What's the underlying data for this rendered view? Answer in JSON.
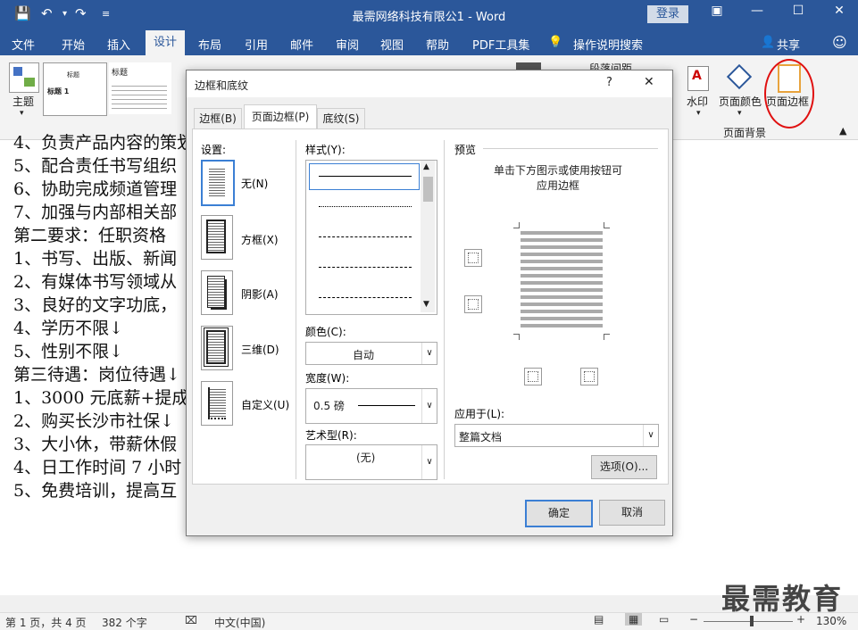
{
  "titlebar": {
    "title": "最需网络科技有限公1  -  Word",
    "login": "登录"
  },
  "menu": {
    "tabs": [
      "文件",
      "开始",
      "插入",
      "设计",
      "布局",
      "引用",
      "邮件",
      "审阅",
      "视图",
      "帮助",
      "PDF工具集"
    ],
    "tell_me": "操作说明搜索",
    "share": "共享"
  },
  "ribbon": {
    "theme_label": "主题",
    "style_title": "标题",
    "style_h1": "标题 1",
    "watermark": "水印",
    "page_color": "页面颜色",
    "page_borders": "页面边框",
    "group_page_bg": "页面背景",
    "paragraph_spacing": "段落间距"
  },
  "document": {
    "lines": [
      "4、负责产品内容的策划",
      "5、配合责任书写组织",
      "6、协助完成频道管理",
      "7、加强与内部相关部",
      "第二要求：任职资格",
      "1、书写、出版、新闻",
      "2、有媒体书写领域从",
      "3、良好的文字功底，",
      "4、学历不限↓",
      "5、性别不限↓",
      "第三待遇：岗位待遇↓",
      "1、3000 元底薪+提成",
      "2、购买长沙市社保↓",
      "3、大小休，带薪休假",
      "4、日工作时间 7 小时",
      "5、免费培训，提高互"
    ]
  },
  "dialog": {
    "title": "边框和底纹",
    "help": "?",
    "close": "✕",
    "tabs": [
      "边框(B)",
      "页面边框(P)",
      "底纹(S)"
    ],
    "settings_label": "设置:",
    "settings": [
      "无(N)",
      "方框(X)",
      "阴影(A)",
      "三维(D)",
      "自定义(U)"
    ],
    "style_label": "样式(Y):",
    "color_label": "颜色(C):",
    "color_value": "自动",
    "width_label": "宽度(W):",
    "width_value": "0.5 磅",
    "art_label": "艺术型(R):",
    "art_value": "(无)",
    "preview_label": "预览",
    "preview_hint": "单击下方图示或使用按钮可应用边框",
    "apply_label": "应用于(L):",
    "apply_value": "整篇文档",
    "options_button": "选项(O)...",
    "ok_button": "确定",
    "cancel_button": "取消"
  },
  "status": {
    "page": "第 1 页，共 4 页",
    "words": "382 个字",
    "lang": "中文(中国)",
    "zoom": "130%"
  },
  "watermark_text": "最需教育"
}
